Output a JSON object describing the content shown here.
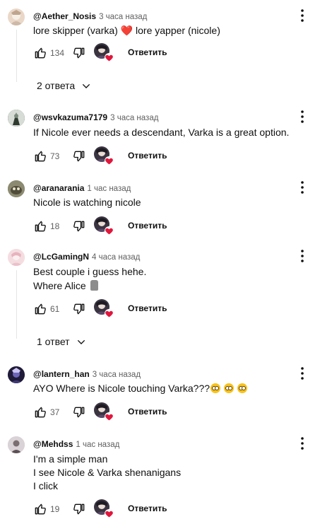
{
  "reply_label": "Ответить",
  "comments": [
    {
      "author": "@Aether_Nosis",
      "time": "3 часа назад",
      "text_parts": [
        "lore skipper (varka) ",
        " lore yapper (nicole)"
      ],
      "likes": "134",
      "replies_label": "2 ответа",
      "avatar_color": "#e9d7c8"
    },
    {
      "author": "@wsvkazuma7179",
      "time": "3 часа назад",
      "lines": [
        "If Nicole ever needs a descendant, Varka is a great option."
      ],
      "likes": "73",
      "avatar_color": "#4a5548"
    },
    {
      "author": "@aranarania",
      "time": "1 час назад",
      "lines": [
        "Nicole is watching nicole"
      ],
      "likes": "18",
      "avatar_color": "#6d6a58"
    },
    {
      "author": "@LcGamingN",
      "time": "4 часа назад",
      "lines": [
        "Best couple i guess hehe.",
        "Where Alice "
      ],
      "likes": "61",
      "replies_label": "1 ответ",
      "avatar_color": "#f1d3d8"
    },
    {
      "author": "@lantern_han",
      "time": "3 часа назад",
      "lines": [
        "AYO Where is Nicole touching Varka???"
      ],
      "likes": "37",
      "avatar_color": "#2b2446"
    },
    {
      "author": "@Mehdss",
      "time": "1 час назад",
      "lines": [
        "I'm a simple man",
        "I see Nicole & Varka shenanigans",
        "I click"
      ],
      "likes": "19",
      "avatar_color": "#cfc6cc"
    }
  ],
  "icons": {
    "like": "thumb-up-icon",
    "dislike": "thumb-down-icon",
    "more": "vertical-dots-icon",
    "creator_heart": "creator-heart-icon",
    "chevron": "chevron-down-icon"
  },
  "colors": {
    "heart": "#e1163c",
    "muted": "#606060",
    "divider": "#e5e5e5"
  }
}
